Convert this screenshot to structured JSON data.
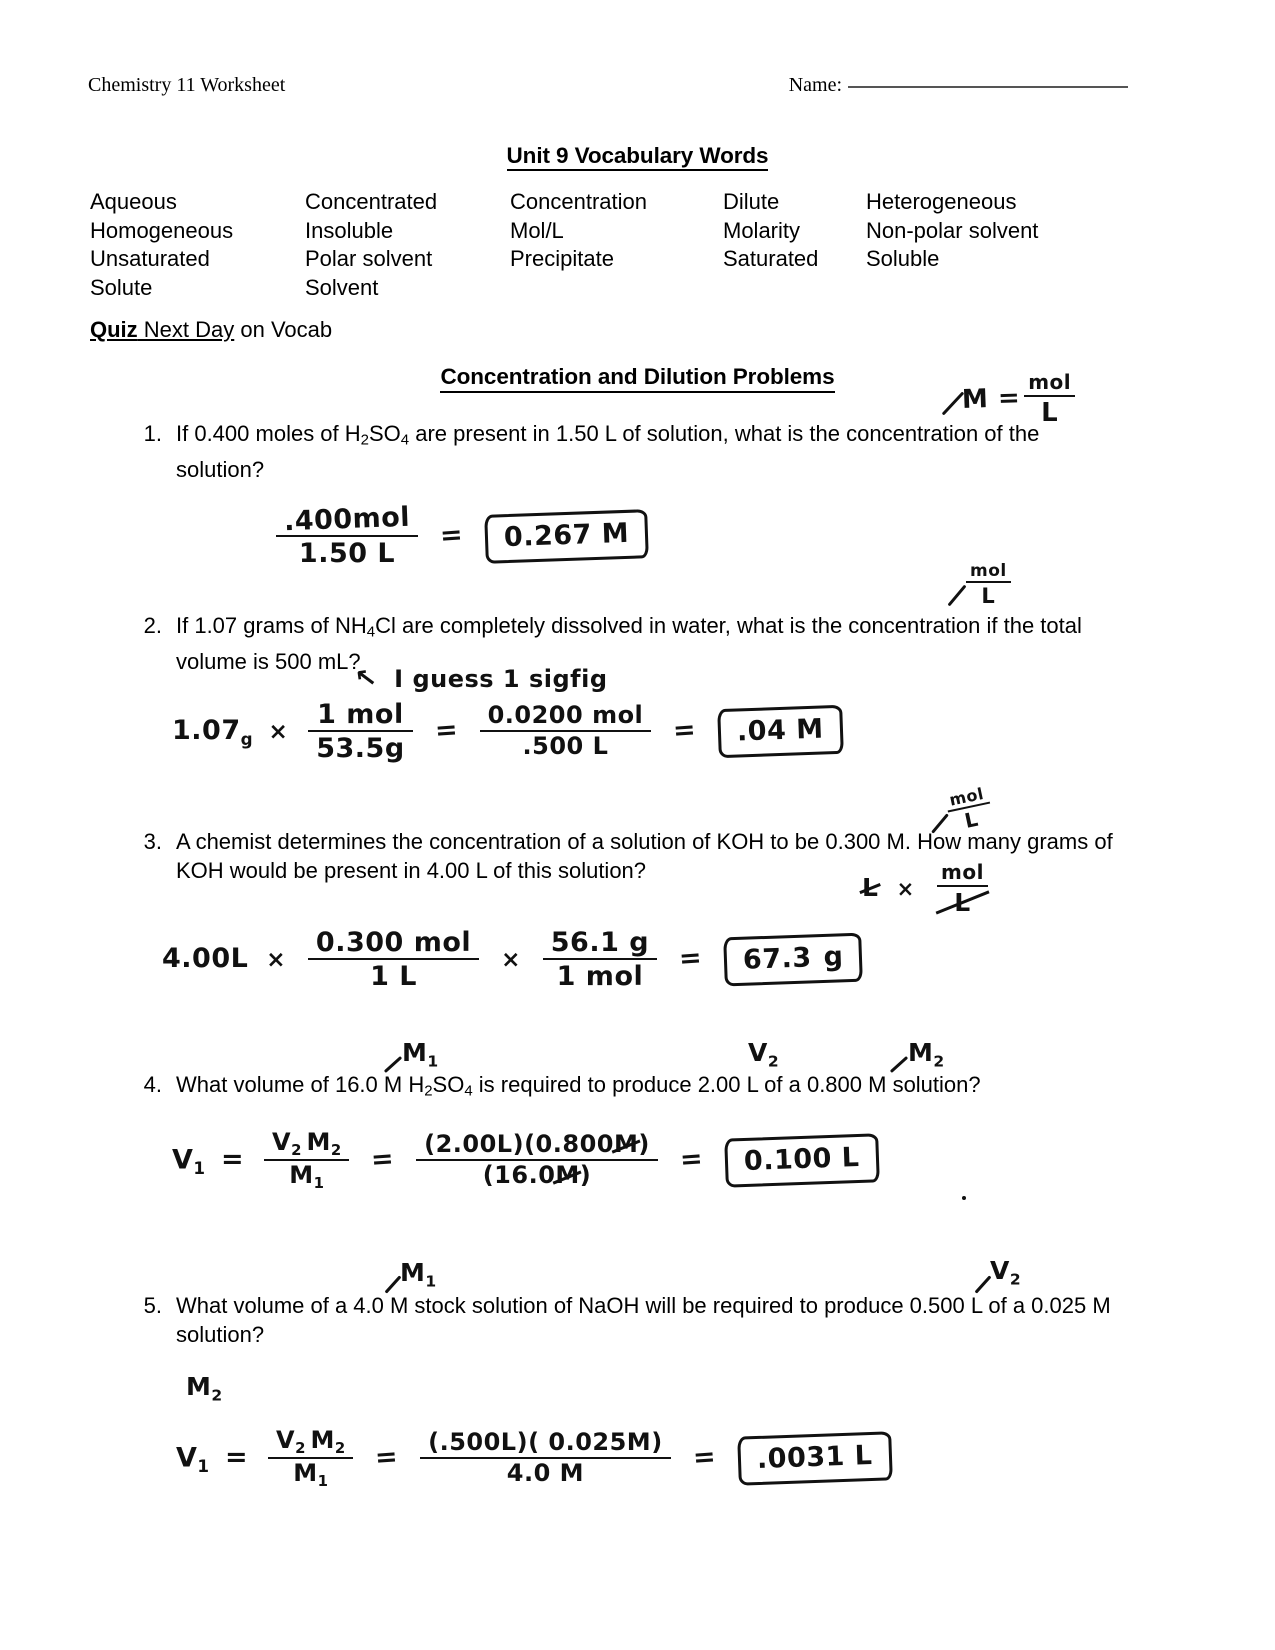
{
  "header": {
    "course_label": "Chemistry 11 Worksheet",
    "name_label": "Name:"
  },
  "vocab": {
    "title": "Unit 9 Vocabulary Words",
    "rows": [
      [
        "Aqueous",
        "Concentrated",
        "Concentration",
        "Dilute",
        "Heterogeneous"
      ],
      [
        "Homogeneous",
        "Insoluble",
        "Mol/L",
        "Molarity",
        "Non-polar solvent"
      ],
      [
        "Unsaturated",
        "Polar solvent",
        "Precipitate",
        "Saturated",
        "Soluble"
      ],
      [
        "Solute",
        "Solvent",
        "",
        "",
        ""
      ]
    ]
  },
  "quiz_note": {
    "bold_part": "Quiz",
    "underline_part": " Next Day",
    "plain_part": " on Vocab"
  },
  "section": {
    "title": "Concentration and Dilution Problems"
  },
  "questions": [
    {
      "number": "1.",
      "text_a": "If 0.400 moles of H",
      "sub_a": "2",
      "text_b": "SO",
      "sub_b": "4",
      "text_c": " are present in 1.50 L of solution, what is the concentration of the solution?"
    },
    {
      "number": "2.",
      "text_a": "If 1.07 grams of NH",
      "sub_a": "4",
      "text_b": "Cl are completely dissolved in water, what is the concentration if the total volume is 500 mL?"
    },
    {
      "number": "3.",
      "text_a": "A chemist determines the concentration of a solution of KOH to be 0.300 M. How many grams of KOH would be present in 4.00 L of this solution?"
    },
    {
      "number": "4.",
      "text_a": "What volume of 16.0 M H",
      "sub_a": "2",
      "text_b": "SO",
      "sub_b": "4",
      "text_c": " is required to produce 2.00 L of a 0.800 M solution?"
    },
    {
      "number": "5.",
      "text_a": "What volume of a 4.0 M stock solution of NaOH will be required to produce 0.500 L of a 0.025 M solution?"
    }
  ],
  "handwriting": {
    "molarity_def": {
      "lhs": "M =",
      "numerator": "mol",
      "denominator": "L"
    },
    "unit_note_q2": {
      "numerator": "mol",
      "denominator": "L"
    },
    "unit_note_q3": {
      "numerator": "mol",
      "denominator": "L"
    },
    "q3_unit_work": {
      "liters": "L",
      "times": "×",
      "numerator": "mol",
      "denominator": "L"
    },
    "q1_work": {
      "numerator": ".400mol",
      "denominator": "1.50 L",
      "equals": "=",
      "answer": "0.267 M"
    },
    "q2_note": {
      "arrow": "↖",
      "text": "I guess 1 sigfig"
    },
    "q2_work": {
      "mass": "1.07",
      "mass_unit": "g",
      "times": "×",
      "f1_num": "1 mol",
      "f1_den": "53.5g",
      "equals1": "=",
      "f2_num": "0.0200 mol",
      "f2_den": ".500 L",
      "equals2": "=",
      "answer": ".04 M"
    },
    "q3_work": {
      "volume": "4.00L",
      "times1": "×",
      "f1_num": "0.300 mol",
      "f1_den": "1 L",
      "times2": "×",
      "f2_num": "56.1 g",
      "f2_den": "1 mol",
      "equals": "=",
      "answer_value": "67.3",
      "answer_unit": "g"
    },
    "q4_labels": {
      "m1": "M",
      "m1_sub": "1",
      "v2": "V",
      "v2_sub": "2",
      "m2": "M",
      "m2_sub": "2"
    },
    "q4_work": {
      "v1": "V",
      "v1_sub": "1",
      "equals0": "=",
      "f1_num_a": "V",
      "f1_num_a_sub": "2",
      "f1_num_b": "M",
      "f1_num_b_sub": "2",
      "f1_den": "M",
      "f1_den_sub": "1",
      "equals1": "=",
      "f2_num_a": "(2.00L)",
      "f2_num_b": "(0.800",
      "f2_num_unit": "M",
      "f2_num_c": ")",
      "f2_den_a": "(16.0",
      "f2_den_unit": "M",
      "f2_den_b": ")",
      "equals2": "=",
      "answer": "0.100 L"
    },
    "q5_labels": {
      "m1": "M",
      "m1_sub": "1",
      "v2": "V",
      "v2_sub": "2",
      "m2": "M",
      "m2_sub": "2"
    },
    "q5_work": {
      "v1": "V",
      "v1_sub": "1",
      "equals0": "=",
      "f1_num_a": "V",
      "f1_num_a_sub": "2",
      "f1_num_b": "M",
      "f1_num_b_sub": "2",
      "f1_den": "M",
      "f1_den_sub": "1",
      "equals1": "=",
      "f2_num": "(.500L)( 0.025M)",
      "f2_den": "4.0 M",
      "equals2": "=",
      "answer": ".0031  L"
    }
  }
}
